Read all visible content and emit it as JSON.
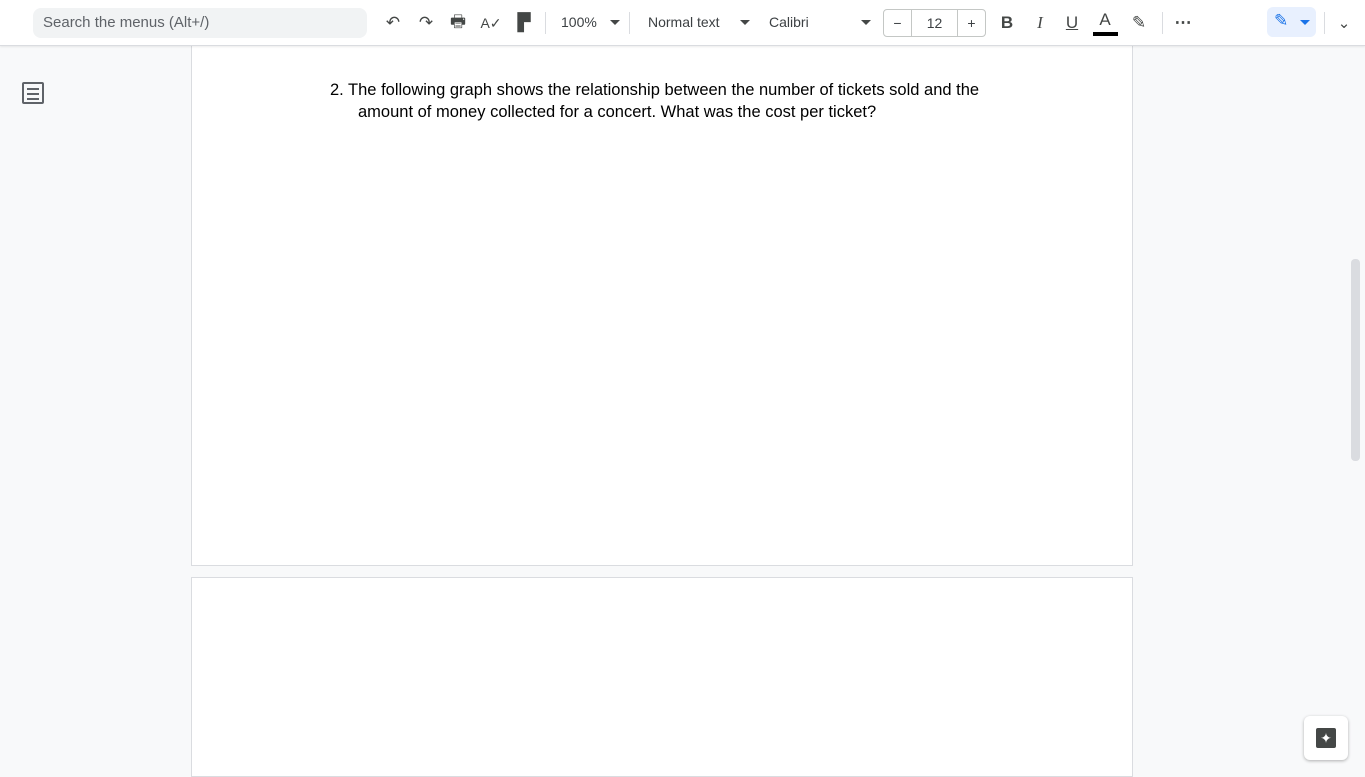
{
  "toolbar": {
    "search_placeholder": "Search the menus (Alt+/)",
    "zoom": "100%",
    "style": "Normal text",
    "font": "Calibri",
    "font_size": "12",
    "decrease": "−",
    "increase": "+",
    "bold": "B",
    "italic": "I",
    "underline": "U",
    "text_color": "A",
    "more": "⋯",
    "text_color_value": "#000000"
  },
  "document": {
    "question_line1": "2. The following graph shows the relationship between the number of tickets sold and the",
    "question_line2": "amount of money collected for a concert. What was the cost per ticket?"
  }
}
